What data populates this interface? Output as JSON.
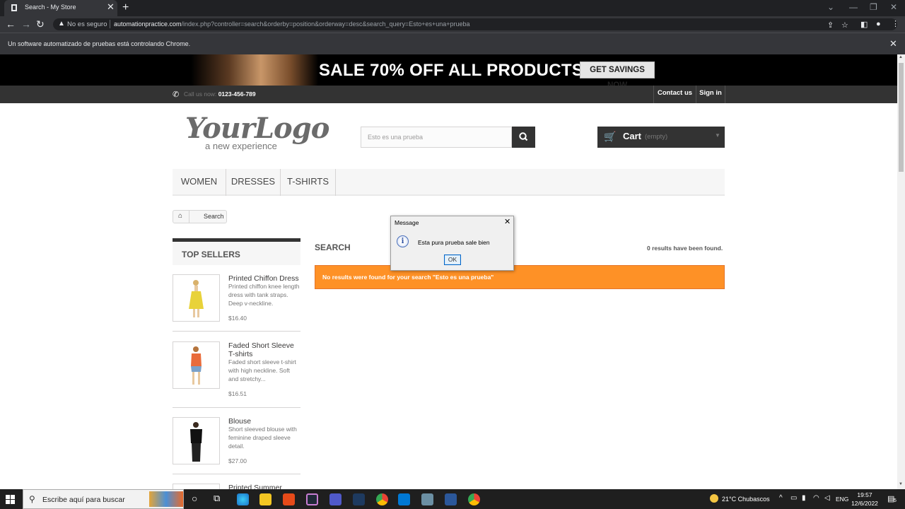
{
  "browser": {
    "tab_title": "Search - My Store",
    "tab_close": "✕",
    "new_tab": "+",
    "security_label": "No es seguro",
    "url_host": "automationpractice.com",
    "url_path": "/index.php?controller=search&orderby=position&orderway=desc&search_query=Esto+es+una+prueba",
    "infobar_message": "Un software automatizado de pruebas está controlando Chrome.",
    "infobar_close": "✕"
  },
  "banner": {
    "headline": "SALE 70% OFF ALL PRODUCTS",
    "cta": "GET SAVINGS NOW"
  },
  "header_bar": {
    "call_label": "Call us now:",
    "phone": "0123-456-789",
    "contact": "Contact us",
    "signin": "Sign in"
  },
  "logo": {
    "main": "YourLogo",
    "tagline": "a new experience"
  },
  "search": {
    "value": "Esto es una prueba"
  },
  "cart": {
    "label": "Cart",
    "status": "(empty)"
  },
  "menu": [
    "WOMEN",
    "DRESSES",
    "T-SHIRTS"
  ],
  "breadcrumb": {
    "current": "Search"
  },
  "top_sellers": {
    "title": "TOP SELLERS",
    "products": [
      {
        "name": "Printed Chiffon Dress",
        "desc": "Printed chiffon knee length dress with tank straps. Deep v-neckline.",
        "price": "$16.40"
      },
      {
        "name": "Faded Short Sleeve T-shirts",
        "desc": "Faded short sleeve t-shirt with high neckline. Soft and stretchy...",
        "price": "$16.51"
      },
      {
        "name": "Blouse",
        "desc": "Short sleeved blouse with feminine draped sleeve detail.",
        "price": "$27.00"
      },
      {
        "name": "Printed Summer",
        "desc": "",
        "price": ""
      }
    ]
  },
  "results": {
    "title": "SEARCH",
    "count_text": "0 results have been found.",
    "alert": "No results were found for your search \"Esto es una prueba\""
  },
  "dialog": {
    "title": "Message",
    "message": "Esta pura prueba sale bien",
    "ok": "OK",
    "close": "✕",
    "icon_letter": "i"
  },
  "taskbar": {
    "search_placeholder": "Escribe aquí para buscar",
    "weather": "21°C  Chubascos",
    "language": "ENG",
    "time": "19:57",
    "date": "12/6/2022",
    "notification_count": "5"
  }
}
